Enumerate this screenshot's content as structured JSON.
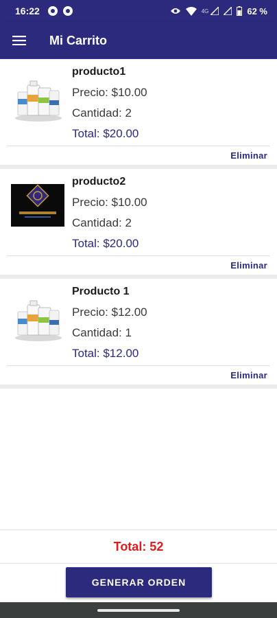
{
  "status_bar": {
    "time": "16:22",
    "network_label": "4G",
    "battery": "62 %"
  },
  "app_bar": {
    "title": "Mi Carrito",
    "menu_icon": "hamburger-menu-icon"
  },
  "cart": {
    "items": [
      {
        "name": "producto1",
        "price": "Precio: $10.00",
        "quantity": "Cantidad: 2",
        "total": "Total: $20.00",
        "delete_label": "Eliminar",
        "image": "bottles"
      },
      {
        "name": "producto2",
        "price": "Precio: $10.00",
        "quantity": "Cantidad: 2",
        "total": "Total: $20.00",
        "delete_label": "Eliminar",
        "image": "logo"
      },
      {
        "name": "Producto 1",
        "price": "Precio: $12.00",
        "quantity": "Cantidad: 1",
        "total": "Total: $12.00",
        "delete_label": "Eliminar",
        "image": "bottles"
      }
    ]
  },
  "footer": {
    "grand_total": "Total: 52",
    "order_button": "GENERAR ORDEN"
  },
  "colors": {
    "primary": "#2b2a7c",
    "total_red": "#e11a1a"
  }
}
